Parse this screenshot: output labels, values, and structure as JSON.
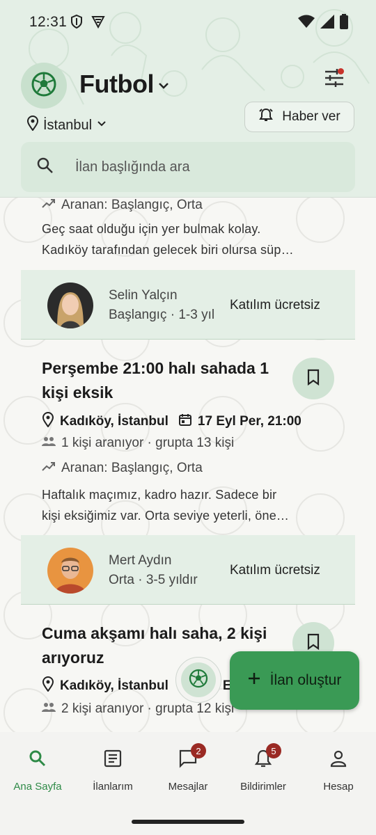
{
  "status_bar": {
    "time": "12:31"
  },
  "header": {
    "sport_title": "Futbol",
    "location": "İstanbul",
    "notify_label": "Haber ver",
    "search_placeholder": "İlan başlığında ara"
  },
  "feed": {
    "partial_card": {
      "wanted": "Aranan: Başlangıç, Orta",
      "desc_lines": [
        "Geç saat olduğu için yer bulmak kolay.",
        "Kadıköy tarafından gelecek biri olursa süp…"
      ],
      "owner": {
        "name": "Selin Yalçın",
        "level": "Başlangıç · 1-3 yıl",
        "fee": "Katılım ücretsiz"
      }
    },
    "card_2": {
      "title": "Perşembe 21:00 halı sahada 1 kişi eksik",
      "location": "Kadıköy, İstanbul",
      "date": "17 Eyl Per, 21:00",
      "people": "1 kişi aranıyor · grupta 13 kişi",
      "wanted": "Aranan: Başlangıç, Orta",
      "desc_lines": [
        "Haftalık maçımız, kadro hazır. Sadece bir",
        "kişi eksiğimiz var. Orta seviye yeterli, öne…"
      ],
      "owner": {
        "name": "Mert Aydın",
        "level": "Orta · 3-5 yıldır",
        "fee": "Katılım ücretsiz"
      }
    },
    "card_3": {
      "title": "Cuma akşamı halı saha, 2 kişi arıyoruz",
      "location": "Kadıköy, İstanbul",
      "date_partial": "E",
      "people": "2 kişi aranıyor · grupta 12 kişi"
    }
  },
  "fab": {
    "label": "İlan oluştur"
  },
  "bottom_nav": {
    "items": [
      {
        "label": "Ana Sayfa",
        "icon": "search-icon",
        "active": true
      },
      {
        "label": "İlanlarım",
        "icon": "article-icon"
      },
      {
        "label": "Mesajlar",
        "icon": "chat-icon",
        "badge": "2"
      },
      {
        "label": "Bildirimler",
        "icon": "bell-icon",
        "badge": "5"
      },
      {
        "label": "Hesap",
        "icon": "person-icon"
      }
    ]
  },
  "colors": {
    "accent": "#2e8a47",
    "fab": "#3a9a55",
    "header_bg": "#e4efe6",
    "badge": "#9a2a24"
  }
}
